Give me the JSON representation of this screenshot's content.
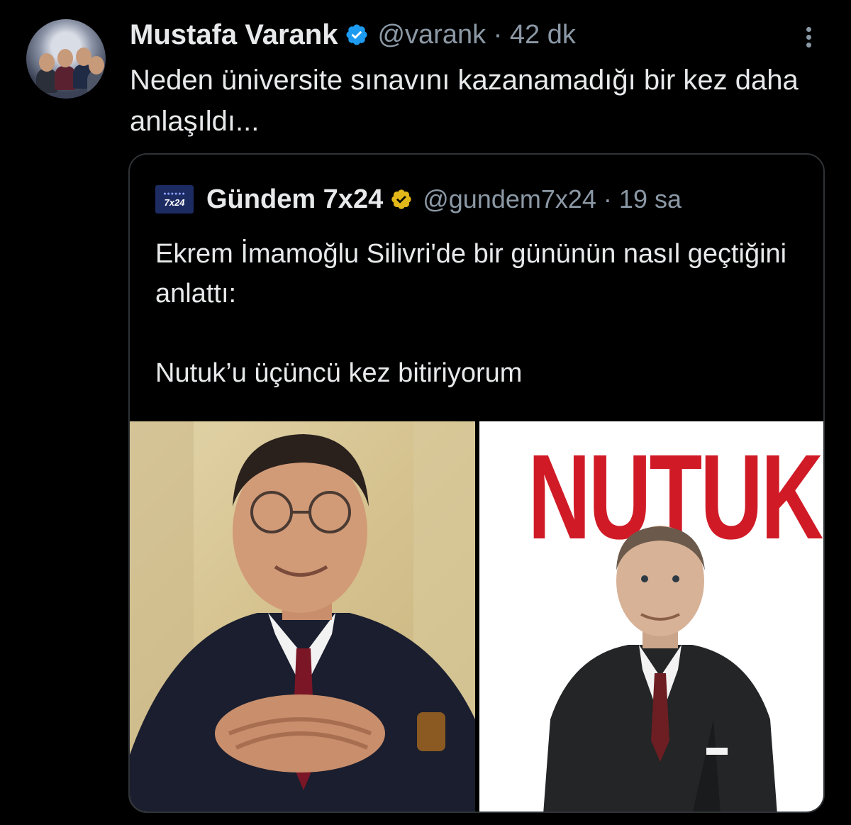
{
  "tweet": {
    "author_name": "Mustafa Varank",
    "handle_time": "@varank · 42 dk",
    "text": "Neden üniversite sınavını kazanamadığı bir kez daha anlaşıldı..."
  },
  "quoted_tweet": {
    "avatar_text": "7x24",
    "author_name": "Gündem 7x24",
    "handle_time": "@gundem7x24 · 19 sa",
    "text": "Ekrem İmamoğlu Silivri'de bir gününün nasıl geçtiğini anlattı:\n\nNutuk’u üçüncü kez bitiriyorum",
    "media_right_title": "NUTUK"
  },
  "icons": [
    "verified-badge-icon",
    "gold-verified-badge-icon",
    "more-options-icon"
  ],
  "colors": {
    "background": "#000000",
    "text": "#e7e9ea",
    "secondary_text": "#8b98a5",
    "blue_badge": "#1d9bf0",
    "gold_badge": "#e2b719",
    "nutuk_red": "#d01b27"
  }
}
